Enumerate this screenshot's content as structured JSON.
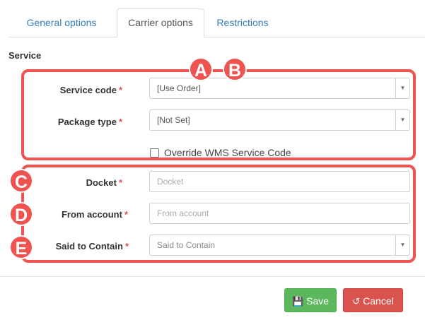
{
  "tabs": {
    "general": "General options",
    "carrier": "Carrier options",
    "restrictions": "Restrictions"
  },
  "section": {
    "title": "Service"
  },
  "fields": {
    "service_code": {
      "label": "Service code",
      "value": "[Use Order]"
    },
    "package_type": {
      "label": "Package type",
      "value": "[Not Set]"
    },
    "override": {
      "label": "Override WMS Service Code"
    },
    "docket": {
      "label": "Docket",
      "placeholder": "Docket"
    },
    "from_account": {
      "label": "From account",
      "placeholder": "From account"
    },
    "said_to_contain": {
      "label": "Said to Contain",
      "value": "Said to Contain"
    }
  },
  "required_mark": "*",
  "badges": {
    "a": "A",
    "b": "B",
    "c": "C",
    "d": "D",
    "e": "E"
  },
  "buttons": {
    "save": "Save",
    "cancel": "Cancel"
  },
  "colors": {
    "accent_red": "#ef5350",
    "link_blue": "#337ab7",
    "save_green": "#5cb85c",
    "cancel_red": "#d9534f"
  }
}
